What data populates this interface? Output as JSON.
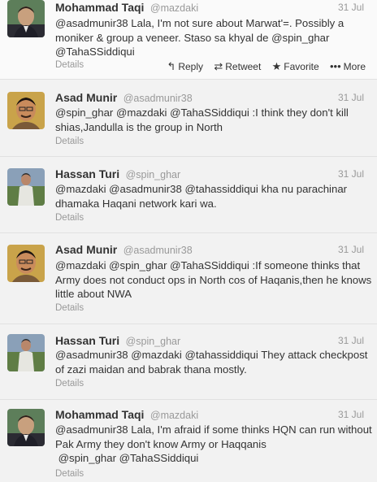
{
  "actions": {
    "reply": "Reply",
    "retweet": "Retweet",
    "favorite": "Favorite",
    "more": "More"
  },
  "tweets": [
    {
      "name": "Mohammad Taqi",
      "handle": "@mazdaki",
      "time": "31 Jul",
      "text": "@asadmunir38 Lala, I'm not sure about Marwat'=. Possibly a moniker & group a veneer. Staso sa khyal de @spin_ghar  @TahaSSiddiqui",
      "details": "Details"
    },
    {
      "name": "Asad Munir",
      "handle": "@asadmunir38",
      "time": "31 Jul",
      "text": "@spin_ghar @mazdaki @TahaSSiddiqui :I think they don't kill shias,Jandulla is the group in North",
      "details": "Details"
    },
    {
      "name": "Hassan Turi",
      "handle": "@spin_ghar",
      "time": "31 Jul",
      "text": "@mazdaki @asadmunir38 @tahassiddiqui kha nu parachinar dhamaka Haqani network kari wa.",
      "details": "Details"
    },
    {
      "name": "Asad Munir",
      "handle": "@asadmunir38",
      "time": "31 Jul",
      "text": "@mazdaki @spin_ghar @TahaSSiddiqui :If someone thinks that Army does not conduct ops in North cos of Haqanis,then he knows little about NWA",
      "details": "Details"
    },
    {
      "name": "Hassan Turi",
      "handle": "@spin_ghar",
      "time": "31 Jul",
      "text": "@asadmunir38 @mazdaki @tahassiddiqui They attack checkpost of zazi maidan and babrak thana mostly.",
      "details": "Details"
    },
    {
      "name": "Mohammad Taqi",
      "handle": "@mazdaki",
      "time": "31 Jul",
      "text": "@asadmunir38 Lala, I'm afraid if some thinks HQN can run without Pak Army they don't know Army or Haqqanis\n @spin_ghar @TahaSSiddiqui",
      "details": "Details"
    }
  ]
}
